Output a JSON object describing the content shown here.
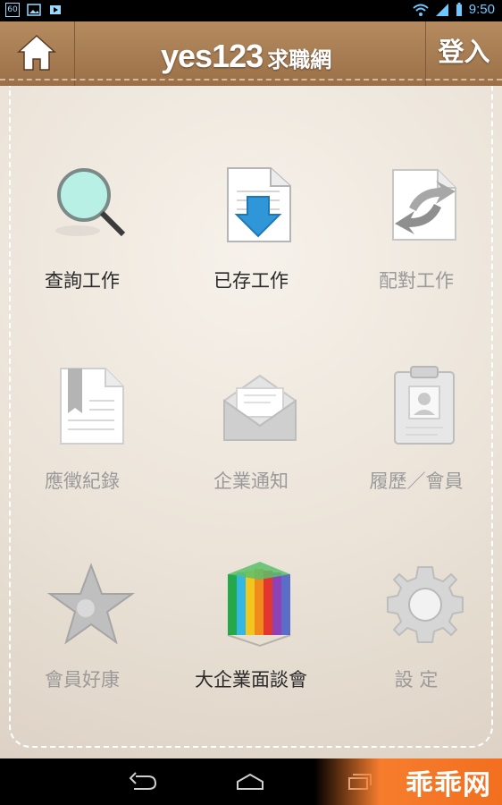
{
  "status_bar": {
    "left_icons": [
      "battery-percent-icon",
      "image-icon",
      "media-icon"
    ],
    "left_text": "60",
    "time": "9:50",
    "right_icons": [
      "wifi-icon",
      "signal-icon",
      "battery-icon"
    ]
  },
  "header": {
    "home_icon": "home-icon",
    "title_main": "yes123",
    "title_sub": "求職網",
    "login_label": "登入"
  },
  "menu": {
    "items": [
      {
        "label": "查詢工作",
        "icon": "magnifier-icon"
      },
      {
        "label": "已存工作",
        "icon": "save-document-icon"
      },
      {
        "label": "配對工作",
        "icon": "match-arrows-icon"
      },
      {
        "label": "應徵紀錄",
        "icon": "bookmark-document-icon"
      },
      {
        "label": "企業通知",
        "icon": "mail-icon"
      },
      {
        "label": "履歷／會員",
        "icon": "resume-card-icon"
      },
      {
        "label": "會員好康",
        "icon": "star-icon"
      },
      {
        "label": "大企業面談會",
        "icon": "color-building-icon"
      },
      {
        "label": "設 定",
        "icon": "gear-icon"
      }
    ]
  },
  "nav_bar": {
    "icons": [
      "back-icon",
      "home-icon",
      "recent-apps-icon"
    ]
  },
  "watermark": {
    "text": "乖乖网"
  }
}
